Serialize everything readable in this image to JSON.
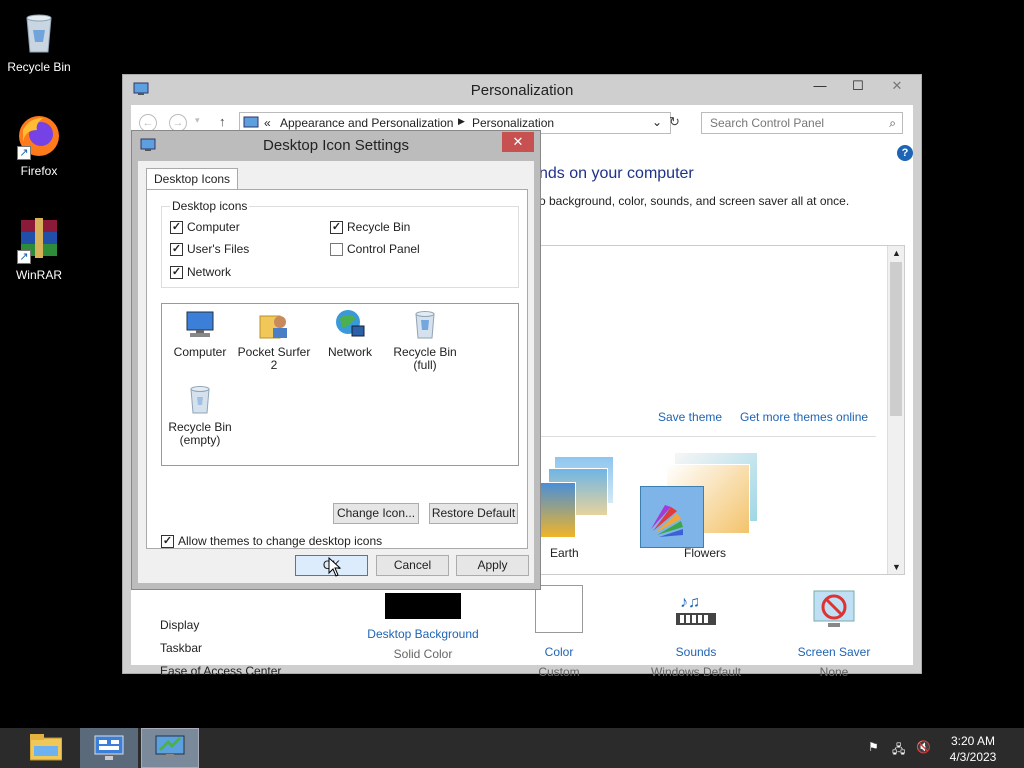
{
  "desktop_icons": [
    {
      "label": "Recycle Bin",
      "icon": "recycle-bin-icon"
    },
    {
      "label": "Firefox",
      "icon": "firefox-icon"
    },
    {
      "label": "WinRAR",
      "icon": "winrar-icon"
    }
  ],
  "personalization": {
    "title": "Personalization",
    "breadcrumb_prefix": "«",
    "breadcrumb": [
      "Appearance and Personalization",
      "Personalization"
    ],
    "search_placeholder": "Search Control Panel",
    "heading_partial": "nds on your computer",
    "subtitle_partial": "o background, color, sounds, and screen saver all at once.",
    "save_theme": "Save theme",
    "get_more_themes": "Get more themes online",
    "themes": [
      {
        "label": "Earth"
      },
      {
        "label": "Flowers"
      }
    ],
    "see_also": [
      "Display",
      "Taskbar",
      "Ease of Access Center"
    ],
    "bottom_items": [
      {
        "label": "Desktop Background",
        "sub": "Solid Color"
      },
      {
        "label": "Color",
        "sub": "Custom"
      },
      {
        "label": "Sounds",
        "sub": "Windows Default"
      },
      {
        "label": "Screen Saver",
        "sub": "None"
      }
    ]
  },
  "dialog": {
    "title": "Desktop Icon Settings",
    "tab": "Desktop Icons",
    "group_label": "Desktop icons",
    "checkboxes": [
      {
        "label": "Computer",
        "checked": true
      },
      {
        "label": "Recycle Bin",
        "checked": true
      },
      {
        "label": "User's Files",
        "checked": true
      },
      {
        "label": "Control Panel",
        "checked": false
      },
      {
        "label": "Network",
        "checked": true
      }
    ],
    "icons": [
      {
        "label": "Computer"
      },
      {
        "label": "Pocket Surfer 2"
      },
      {
        "label": "Network"
      },
      {
        "label": "Recycle Bin (full)"
      },
      {
        "label": "Recycle Bin (empty)"
      }
    ],
    "change_icon": "Change Icon...",
    "restore_default": "Restore Default",
    "allow_themes": "Allow themes to change desktop icons",
    "allow_themes_checked": true,
    "ok": "OK",
    "cancel": "Cancel",
    "apply": "Apply"
  },
  "taskbar": {
    "time": "3:20 AM",
    "date": "4/3/2023"
  }
}
